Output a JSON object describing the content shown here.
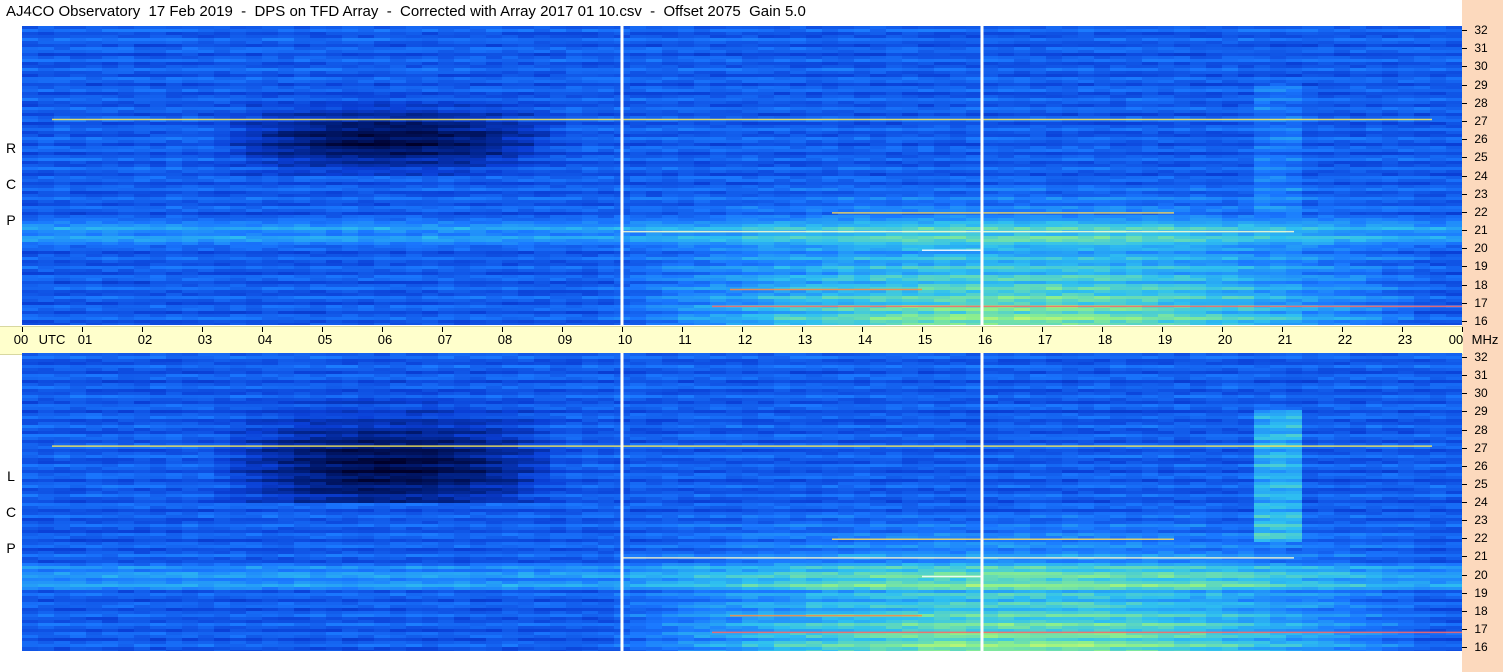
{
  "title": "AJ4CO Observatory  17 Feb 2019  -  DPS on TFD Array  -  Corrected with Array 2017 01 10.csv  -  Offset 2075  Gain 5.0",
  "colors": {
    "colormap": [
      "#00002a",
      "#001d7a",
      "#0a3fd6",
      "#1a78ff",
      "#2fc0f0",
      "#8ff08a",
      "#ffff55",
      "#ff3030"
    ],
    "timebar": "#ffffcc",
    "freq_axis": "#fcd9bd"
  },
  "chart_data": {
    "type": "heatmap",
    "x_axis": {
      "unit_label": "UTC",
      "tick_labels": [
        "00",
        "01",
        "02",
        "03",
        "04",
        "05",
        "06",
        "07",
        "08",
        "09",
        "10",
        "11",
        "12",
        "13",
        "14",
        "15",
        "16",
        "17",
        "18",
        "19",
        "20",
        "21",
        "22",
        "23",
        "00"
      ],
      "range_hours": [
        0,
        24
      ]
    },
    "y_axis": {
      "unit_label": "MHz",
      "tick_labels": [
        "16",
        "17",
        "18",
        "19",
        "20",
        "21",
        "22",
        "23",
        "24",
        "25",
        "26",
        "27",
        "28",
        "29",
        "30",
        "31",
        "32"
      ],
      "range_mhz": [
        16,
        32
      ]
    },
    "panels": [
      {
        "label": "R C P",
        "polarization": "RCP"
      },
      {
        "label": "L C P",
        "polarization": "LCP"
      }
    ],
    "marker_lines_utc_hours": [
      10,
      16
    ],
    "notable_features": {
      "bright_band_mhz": 21,
      "dark_band_mhz": 26,
      "quiet_period_utc_hours": [
        3,
        9
      ]
    }
  }
}
